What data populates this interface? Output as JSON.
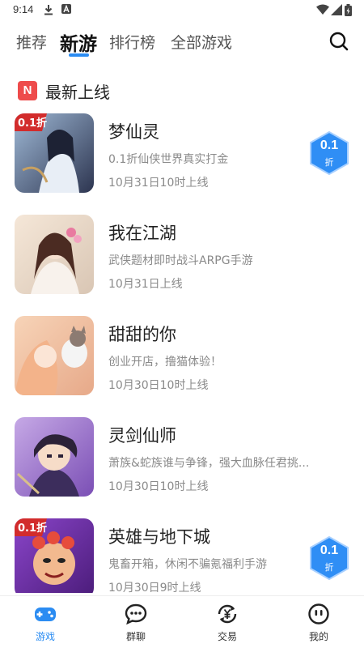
{
  "status_bar": {
    "time": "9:14"
  },
  "tabs": [
    {
      "label": "推荐",
      "active": false
    },
    {
      "label": "新游",
      "active": true
    },
    {
      "label": "排行榜",
      "active": false
    },
    {
      "label": "全部游戏",
      "active": false
    }
  ],
  "section": {
    "badge": "N",
    "title": "最新上线"
  },
  "games": [
    {
      "name": "梦仙灵",
      "desc": "0.1折仙侠世界真实打金",
      "date": "10月31日10时上线",
      "discount": {
        "value": "0.1",
        "unit": "折"
      },
      "icon_label": "0.1折"
    },
    {
      "name": "我在江湖",
      "desc": "武侠题材即时战斗ARPG手游",
      "date": "10月31日上线"
    },
    {
      "name": "甜甜的你",
      "desc": "创业开店，撸猫体验！",
      "date": "10月30日10时上线"
    },
    {
      "name": "灵剑仙师",
      "desc": "萧族&蛇族谁与争锋，强大血脉任君挑...",
      "date": "10月30日10时上线"
    },
    {
      "name": "英雄与地下城",
      "desc": "鬼畜开箱，休闲不骗氪福利手游",
      "date": "10月30日9时上线",
      "discount": {
        "value": "0.1",
        "unit": "折"
      },
      "icon_label": "0.1折"
    }
  ],
  "bottom_nav": [
    {
      "label": "游戏",
      "icon": "gamepad-icon",
      "active": true
    },
    {
      "label": "群聊",
      "icon": "chat-icon",
      "active": false
    },
    {
      "label": "交易",
      "icon": "trade-icon",
      "active": false
    },
    {
      "label": "我的",
      "icon": "profile-icon",
      "active": false
    }
  ],
  "colors": {
    "accent": "#2b8cf2",
    "badge_red": "#ee4b4b",
    "discount_blue": "#2f8ef5",
    "secondary_text": "#8a8a8a"
  }
}
